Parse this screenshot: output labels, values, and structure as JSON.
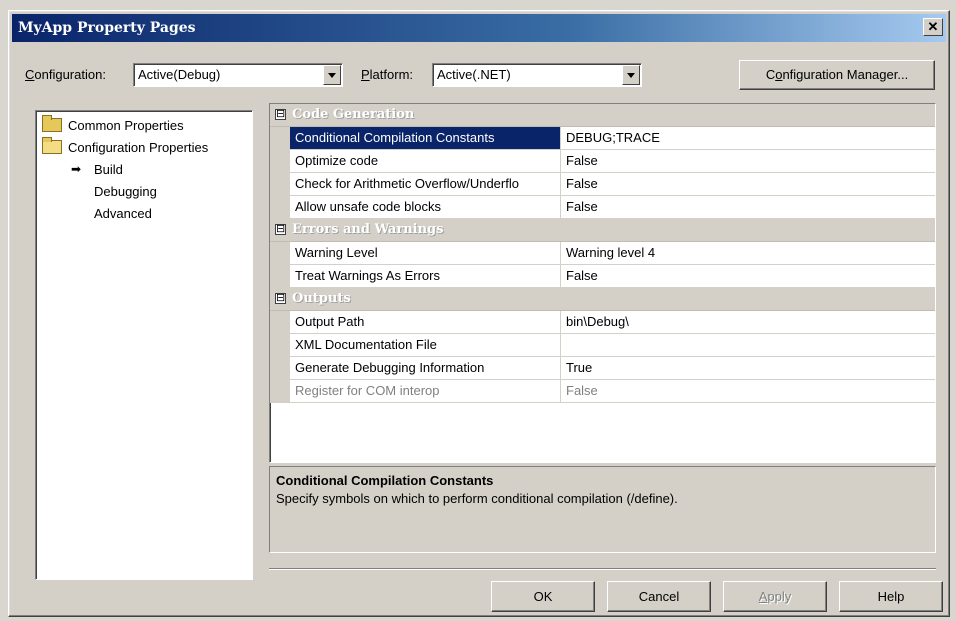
{
  "window": {
    "title": "MyApp Property Pages",
    "close_label": "✕"
  },
  "config_bar": {
    "configuration_label_u": "C",
    "configuration_label_rest": "onfiguration:",
    "configuration_value": "Active(Debug)",
    "platform_label_u": "P",
    "platform_label_rest": "latform:",
    "platform_value": "Active(.NET)",
    "manager_button_u": "o",
    "manager_button_pre": "C",
    "manager_button_rest": "nfiguration Manager..."
  },
  "tree": {
    "items": [
      {
        "label": "Common Properties",
        "icon": "folder-closed-icon"
      },
      {
        "label": "Configuration Properties",
        "icon": "folder-open-icon"
      },
      {
        "label": "Build",
        "icon": "arrow-right-icon"
      },
      {
        "label": "Debugging"
      },
      {
        "label": "Advanced"
      }
    ]
  },
  "grid": {
    "categories": [
      {
        "name": "Code Generation",
        "expander": "⊟",
        "rows": [
          {
            "name": "Conditional Compilation Constants",
            "value": "DEBUG;TRACE",
            "selected": true
          },
          {
            "name": "Optimize code",
            "value": "False"
          },
          {
            "name": "Check for Arithmetic Overflow/Underflo",
            "value": "False"
          },
          {
            "name": "Allow unsafe code blocks",
            "value": "False"
          }
        ]
      },
      {
        "name": "Errors and Warnings",
        "expander": "⊟",
        "rows": [
          {
            "name": "Warning Level",
            "value": "Warning level 4"
          },
          {
            "name": "Treat Warnings As Errors",
            "value": "False"
          }
        ]
      },
      {
        "name": "Outputs",
        "expander": "⊟",
        "rows": [
          {
            "name": "Output Path",
            "value": "bin\\Debug\\"
          },
          {
            "name": "XML Documentation File",
            "value": ""
          },
          {
            "name": "Generate Debugging Information",
            "value": "True"
          },
          {
            "name": "Register for COM interop",
            "value": "False",
            "disabled": true
          }
        ]
      }
    ]
  },
  "description": {
    "title": "Conditional Compilation Constants",
    "text": "Specify symbols on which to perform conditional compilation (/define)."
  },
  "buttons": {
    "ok": "OK",
    "cancel": "Cancel",
    "apply_u": "A",
    "apply_rest": "pply",
    "help": "Help"
  }
}
